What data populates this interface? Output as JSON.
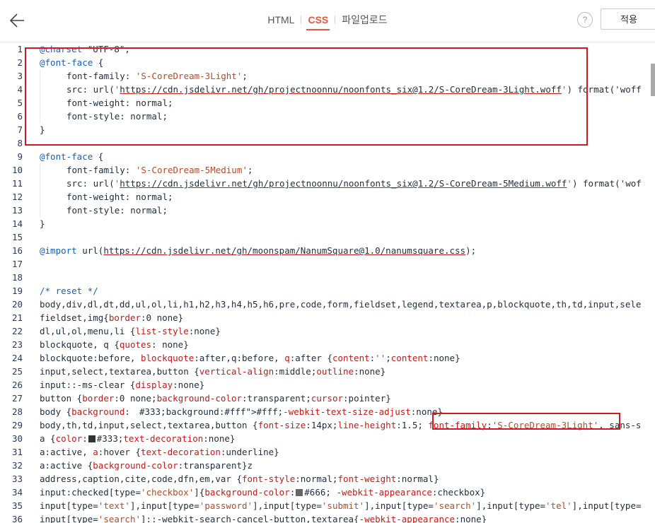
{
  "header": {
    "tabs": [
      "HTML",
      "CSS",
      "파일업로드"
    ],
    "active_tab": "CSS",
    "help_label": "?",
    "apply_label": "적용"
  },
  "colors": {
    "accent": "#e8543f",
    "highlight_box": "#d01a22"
  },
  "icons": {
    "back": "arrow-left-icon",
    "help": "question-circle-icon"
  },
  "editor": {
    "lines": [
      {
        "n": "1",
        "i": 0,
        "t": "@charset \"UTF-8\";"
      },
      {
        "n": "2",
        "i": 0,
        "t": "@font-face {"
      },
      {
        "n": "3",
        "i": 1,
        "t": "font-family: 'S-CoreDream-3Light';"
      },
      {
        "n": "4",
        "i": 1,
        "t": "src: url('https://cdn.jsdelivr.net/gh/projectnoonnu/noonfonts_six@1.2/S-CoreDream-3Light.woff') format('woff"
      },
      {
        "n": "5",
        "i": 1,
        "t": "font-weight: normal;"
      },
      {
        "n": "6",
        "i": 1,
        "t": "font-style: normal;"
      },
      {
        "n": "7",
        "i": 0,
        "t": "}"
      },
      {
        "n": "8",
        "i": 0,
        "t": ""
      },
      {
        "n": "9",
        "i": 0,
        "t": "@font-face {"
      },
      {
        "n": "10",
        "i": 1,
        "t": "font-family: 'S-CoreDream-5Medium';"
      },
      {
        "n": "11",
        "i": 1,
        "t": "src: url('https://cdn.jsdelivr.net/gh/projectnoonnu/noonfonts_six@1.2/S-CoreDream-5Medium.woff') format('wof"
      },
      {
        "n": "12",
        "i": 1,
        "t": "font-weight: normal;"
      },
      {
        "n": "13",
        "i": 1,
        "t": "font-style: normal;"
      },
      {
        "n": "14",
        "i": 0,
        "t": "}"
      },
      {
        "n": "15",
        "i": 0,
        "t": ""
      },
      {
        "n": "16",
        "i": 0,
        "t": "@import url(https://cdn.jsdelivr.net/gh/moonspam/NanumSquare@1.0/nanumsquare.css);"
      },
      {
        "n": "17",
        "i": 0,
        "t": ""
      },
      {
        "n": "18",
        "i": 0,
        "t": ""
      },
      {
        "n": "19",
        "i": 0,
        "t": "/* reset */"
      },
      {
        "n": "20",
        "i": 0,
        "t": "body,div,dl,dt,dd,ul,ol,li,h1,h2,h3,h4,h5,h6,pre,code,form,fieldset,legend,textarea,p,blockquote,th,td,input,sele"
      },
      {
        "n": "21",
        "i": 0,
        "t": "fieldset,img{border:0 none}"
      },
      {
        "n": "22",
        "i": 0,
        "t": "dl,ul,ol,menu,li {list-style:none}"
      },
      {
        "n": "23",
        "i": 0,
        "t": "blockquote, q {quotes: none}"
      },
      {
        "n": "24",
        "i": 0,
        "t": "blockquote:before, blockquote:after,q:before, q:after {content:'';content:none}"
      },
      {
        "n": "25",
        "i": 0,
        "t": "input,select,textarea,button {vertical-align:middle;outline:none}"
      },
      {
        "n": "26",
        "i": 0,
        "t": "input::-ms-clear {display:none}"
      },
      {
        "n": "27",
        "i": 0,
        "t": "button {border:0 none;background-color:transparent;cursor:pointer}"
      },
      {
        "n": "28",
        "i": 0,
        "t": "body {background:#fff;-webkit-text-size-adjust:none}"
      },
      {
        "n": "29",
        "i": 0,
        "t": "body,th,td,input,select,textarea,button {font-size:14px;line-height:1.5; font-family:'S-CoreDream-3Light', sans-s"
      },
      {
        "n": "30",
        "i": 0,
        "t": "a {color:#333;text-decoration:none}"
      },
      {
        "n": "31",
        "i": 0,
        "t": "a:active, a:hover {text-decoration:underline}"
      },
      {
        "n": "32",
        "i": 0,
        "t": "a:active {background-color:transparent}z"
      },
      {
        "n": "33",
        "i": 0,
        "t": "address,caption,cite,code,dfn,em,var {font-style:normal;font-weight:normal}"
      },
      {
        "n": "34",
        "i": 0,
        "t": "input:checked[type='checkbox']{background-color:#666; -webkit-appearance:checkbox}"
      },
      {
        "n": "35",
        "i": 0,
        "t": "input[type='text'],input[type='password'],input[type='submit'],input[type='search'],input[type='tel'],input[type="
      },
      {
        "n": "36",
        "i": 0,
        "t": "input[type='search']::-webkit-search-cancel-button,textarea{-webkit-appearance:none}"
      }
    ]
  }
}
